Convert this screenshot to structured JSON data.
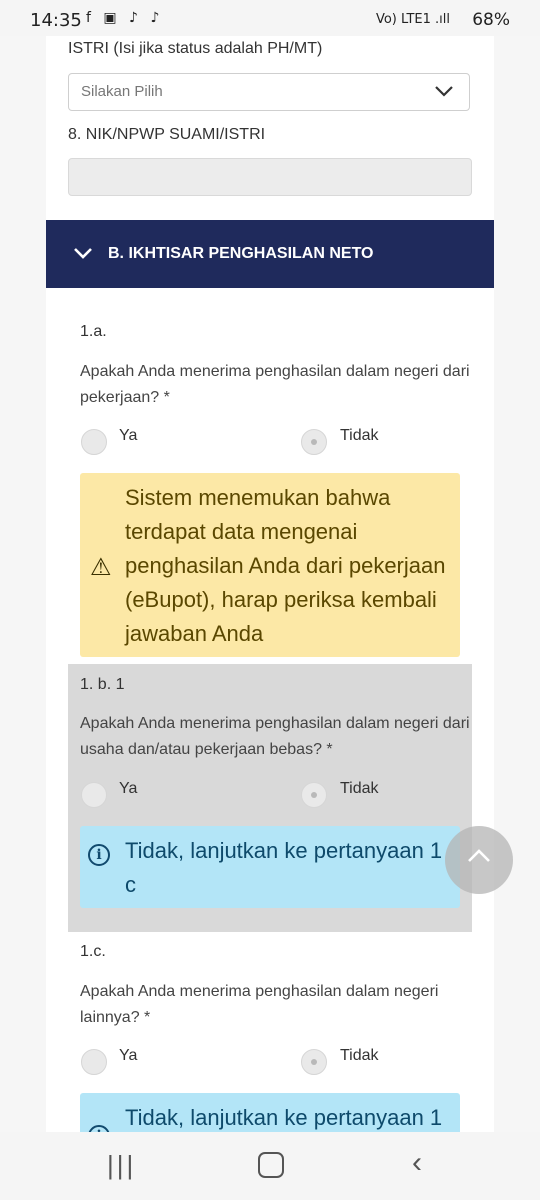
{
  "status_bar": {
    "time": "14:35",
    "app_icons": "f ▣ ♪ ♪",
    "signal": "Vo) LTE1 .ıll",
    "battery": "68%"
  },
  "form": {
    "spouse_status_label": "ISTRI (Isi jika status adalah PH/MT)",
    "select_placeholder": "Silakan Pilih",
    "nik_label": "8. NIK/NPWP SUAMI/ISTRI"
  },
  "section_b": {
    "title": "B. IKHTISAR PENGHASILAN NETO"
  },
  "q1a": {
    "code": "1.a.",
    "text": "Apakah Anda menerima penghasilan dalam negeri dari pekerjaan? *",
    "opt_yes": "Ya",
    "opt_no": "Tidak",
    "warning": "Sistem menemukan bahwa terdapat data mengenai penghasilan Anda dari pekerjaan (eBupot), harap periksa kembali jawaban Anda"
  },
  "q1b1": {
    "code": "1. b. 1",
    "text": "Apakah Anda menerima penghasilan dalam negeri dari usaha dan/atau pekerjaan bebas? *",
    "opt_yes": "Ya",
    "opt_no": "Tidak",
    "info": "Tidak, lanjutkan ke pertanyaan 1 c"
  },
  "q1c": {
    "code": "1.c.",
    "text": "Apakah Anda menerima penghasilan dalam negeri lainnya? *",
    "opt_yes": "Ya",
    "opt_no": "Tidak",
    "info": "Tidak, lanjutkan ke pertanyaan 1"
  },
  "icons": {
    "chevron": "chevron-down-icon",
    "warning": "warning-icon",
    "info": "info-icon",
    "scroll_top": "chevron-up-icon"
  },
  "colors": {
    "section_header_bg": "#1f2a5c",
    "warning_bg": "#fce8a6",
    "info_bg": "#b3e5f7",
    "grey_block_bg": "#d9d9d9"
  }
}
